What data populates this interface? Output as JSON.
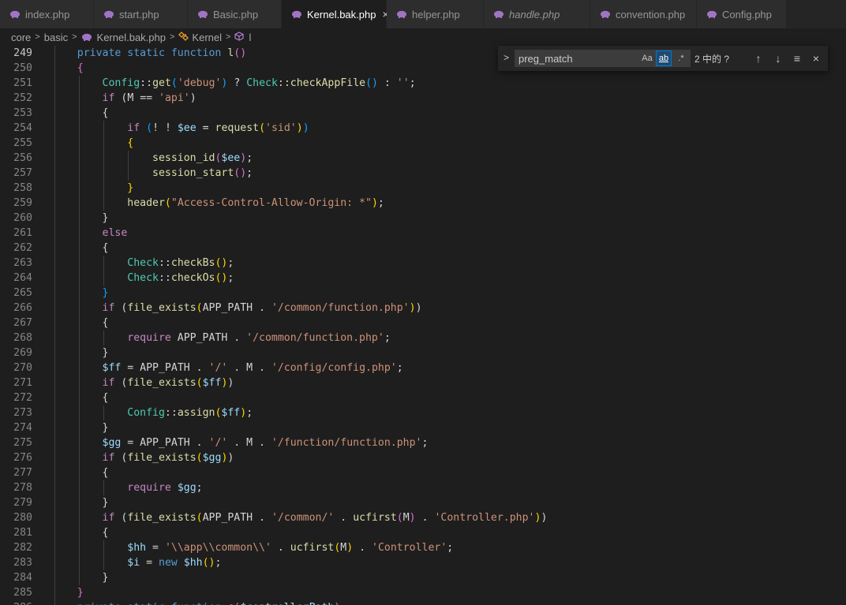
{
  "tabs": [
    {
      "label": "index.php",
      "active": false,
      "italic": false
    },
    {
      "label": "start.php",
      "active": false,
      "italic": false
    },
    {
      "label": "Basic.php",
      "active": false,
      "italic": false
    },
    {
      "label": "Kernel.bak.php",
      "active": true,
      "italic": false,
      "close": "×"
    },
    {
      "label": "helper.php",
      "active": false,
      "italic": false
    },
    {
      "label": "handle.php",
      "active": false,
      "italic": true
    },
    {
      "label": "convention.php",
      "active": false,
      "italic": false
    },
    {
      "label": "Config.php",
      "active": false,
      "italic": false
    }
  ],
  "breadcrumb": {
    "folder1": "core",
    "folder2": "basic",
    "file": "Kernel.bak.php",
    "class": "Kernel",
    "method": "l",
    "separator": ">"
  },
  "find_widget": {
    "query": "preg_match",
    "match_case": "Aa",
    "whole_word": "ab",
    "regex": ".*",
    "result": "2 中的 ?",
    "prev": "↑",
    "next": "↓",
    "selection": "≡",
    "close": "×",
    "toggle": ">"
  },
  "editor": {
    "current_line": 249,
    "lines": [
      {
        "n": "249",
        "t": [
          [
            "    ",
            ""
          ],
          [
            "private static function ",
            "kw"
          ],
          [
            "l",
            "fn"
          ],
          [
            "()",
            "b2"
          ]
        ]
      },
      {
        "n": "250",
        "t": [
          [
            "    ",
            ""
          ],
          [
            "{",
            "b2"
          ]
        ]
      },
      {
        "n": "251",
        "t": [
          [
            "        ",
            ""
          ],
          [
            "Config",
            "cls"
          ],
          [
            "::",
            ""
          ],
          [
            "get",
            "fn"
          ],
          [
            "(",
            "b3"
          ],
          [
            "'debug'",
            "str"
          ],
          [
            "b3_close",
            "b3"
          ],
          [
            " ? ",
            ""
          ],
          [
            "Check",
            "cls"
          ],
          [
            "::",
            ""
          ],
          [
            "checkAppFile",
            "fn"
          ],
          [
            "()",
            "b3"
          ],
          [
            " : ",
            ""
          ],
          [
            "''",
            "str"
          ],
          [
            ";",
            ""
          ]
        ]
      },
      {
        "n": "252",
        "t": [
          [
            "        ",
            ""
          ],
          [
            "if",
            "ctl"
          ],
          [
            " (",
            ""
          ],
          [
            "M == ",
            ""
          ],
          [
            "'api'",
            "str"
          ],
          [
            ")",
            ""
          ]
        ]
      },
      {
        "n": "253",
        "t": [
          [
            "        ",
            ""
          ],
          [
            "{",
            ""
          ]
        ]
      },
      {
        "n": "254",
        "t": [
          [
            "            ",
            ""
          ],
          [
            "if",
            "ctl"
          ],
          [
            " ",
            ""
          ],
          [
            "(",
            "b3"
          ],
          [
            "! ! ",
            ""
          ],
          [
            "$ee",
            "var"
          ],
          [
            " = ",
            ""
          ],
          [
            "request",
            "fn"
          ],
          [
            "(",
            "b1"
          ],
          [
            "'sid'",
            "str"
          ],
          [
            ")",
            "b1"
          ],
          [
            ")",
            "b3"
          ]
        ]
      },
      {
        "n": "255",
        "t": [
          [
            "            ",
            ""
          ],
          [
            "{",
            "b1"
          ]
        ]
      },
      {
        "n": "256",
        "t": [
          [
            "                ",
            ""
          ],
          [
            "session_id",
            "fn"
          ],
          [
            "(",
            "b2"
          ],
          [
            "$ee",
            "var"
          ],
          [
            ")",
            "b2"
          ],
          [
            ";",
            ""
          ]
        ]
      },
      {
        "n": "257",
        "t": [
          [
            "                ",
            ""
          ],
          [
            "session_start",
            "fn"
          ],
          [
            "()",
            "b2"
          ],
          [
            ";",
            ""
          ]
        ]
      },
      {
        "n": "258",
        "t": [
          [
            "            ",
            ""
          ],
          [
            "}",
            "b1"
          ]
        ]
      },
      {
        "n": "259",
        "t": [
          [
            "            ",
            ""
          ],
          [
            "header",
            "fn"
          ],
          [
            "(",
            "b1"
          ],
          [
            "\"Access-Control-Allow-Origin: *\"",
            "str"
          ],
          [
            ")",
            "b1"
          ],
          [
            ";",
            ""
          ]
        ]
      },
      {
        "n": "260",
        "t": [
          [
            "        ",
            ""
          ],
          [
            "}",
            ""
          ]
        ]
      },
      {
        "n": "261",
        "t": [
          [
            "        ",
            ""
          ],
          [
            "else",
            "ctl"
          ]
        ]
      },
      {
        "n": "262",
        "t": [
          [
            "        ",
            ""
          ],
          [
            "{",
            ""
          ]
        ]
      },
      {
        "n": "263",
        "t": [
          [
            "            ",
            ""
          ],
          [
            "Check",
            "cls"
          ],
          [
            "::",
            ""
          ],
          [
            "checkBs",
            "fn"
          ],
          [
            "()",
            "b1"
          ],
          [
            ";",
            ""
          ]
        ]
      },
      {
        "n": "264",
        "t": [
          [
            "            ",
            ""
          ],
          [
            "Check",
            "cls"
          ],
          [
            "::",
            ""
          ],
          [
            "checkOs",
            "fn"
          ],
          [
            "()",
            "b1"
          ],
          [
            ";",
            ""
          ]
        ]
      },
      {
        "n": "265",
        "t": [
          [
            "        ",
            ""
          ],
          [
            "}",
            "b3"
          ]
        ]
      },
      {
        "n": "266",
        "t": [
          [
            "        ",
            ""
          ],
          [
            "if",
            "ctl"
          ],
          [
            " (",
            ""
          ],
          [
            "file_exists",
            "fn"
          ],
          [
            "(",
            "b1"
          ],
          [
            "APP_PATH . ",
            ""
          ],
          [
            "'/common/function.php'",
            "str"
          ],
          [
            ")",
            "b1"
          ],
          [
            ")",
            ""
          ]
        ]
      },
      {
        "n": "267",
        "t": [
          [
            "        ",
            ""
          ],
          [
            "{",
            ""
          ]
        ]
      },
      {
        "n": "268",
        "t": [
          [
            "            ",
            ""
          ],
          [
            "require",
            "ctl"
          ],
          [
            " APP_PATH . ",
            ""
          ],
          [
            "'/common/function.php'",
            "str"
          ],
          [
            ";",
            ""
          ]
        ]
      },
      {
        "n": "269",
        "t": [
          [
            "        ",
            ""
          ],
          [
            "}",
            ""
          ]
        ]
      },
      {
        "n": "270",
        "t": [
          [
            "        ",
            ""
          ],
          [
            "$ff",
            "var"
          ],
          [
            " = APP_PATH . ",
            ""
          ],
          [
            "'/'",
            "str"
          ],
          [
            " . M . ",
            ""
          ],
          [
            "'/config/config.php'",
            "str"
          ],
          [
            ";",
            ""
          ]
        ]
      },
      {
        "n": "271",
        "t": [
          [
            "        ",
            ""
          ],
          [
            "if",
            "ctl"
          ],
          [
            " (",
            ""
          ],
          [
            "file_exists",
            "fn"
          ],
          [
            "(",
            "b1"
          ],
          [
            "$ff",
            "var"
          ],
          [
            ")",
            "b1"
          ],
          [
            ")",
            ""
          ]
        ]
      },
      {
        "n": "272",
        "t": [
          [
            "        ",
            ""
          ],
          [
            "{",
            ""
          ]
        ]
      },
      {
        "n": "273",
        "t": [
          [
            "            ",
            ""
          ],
          [
            "Config",
            "cls"
          ],
          [
            "::",
            ""
          ],
          [
            "assign",
            "fn"
          ],
          [
            "(",
            "b1"
          ],
          [
            "$ff",
            "var"
          ],
          [
            ")",
            "b1"
          ],
          [
            ";",
            ""
          ]
        ]
      },
      {
        "n": "274",
        "t": [
          [
            "        ",
            ""
          ],
          [
            "}",
            ""
          ]
        ]
      },
      {
        "n": "275",
        "t": [
          [
            "        ",
            ""
          ],
          [
            "$gg",
            "var"
          ],
          [
            " = APP_PATH . ",
            ""
          ],
          [
            "'/'",
            "str"
          ],
          [
            " . M . ",
            ""
          ],
          [
            "'/function/function.php'",
            "str"
          ],
          [
            ";",
            ""
          ]
        ]
      },
      {
        "n": "276",
        "t": [
          [
            "        ",
            ""
          ],
          [
            "if",
            "ctl"
          ],
          [
            " (",
            ""
          ],
          [
            "file_exists",
            "fn"
          ],
          [
            "(",
            "b1"
          ],
          [
            "$gg",
            "var"
          ],
          [
            ")",
            "b1"
          ],
          [
            ")",
            ""
          ]
        ]
      },
      {
        "n": "277",
        "t": [
          [
            "        ",
            ""
          ],
          [
            "{",
            ""
          ]
        ]
      },
      {
        "n": "278",
        "t": [
          [
            "            ",
            ""
          ],
          [
            "require",
            "ctl"
          ],
          [
            " ",
            ""
          ],
          [
            "$gg",
            "var"
          ],
          [
            ";",
            ""
          ]
        ]
      },
      {
        "n": "279",
        "t": [
          [
            "        ",
            ""
          ],
          [
            "}",
            ""
          ]
        ]
      },
      {
        "n": "280",
        "t": [
          [
            "        ",
            ""
          ],
          [
            "if",
            "ctl"
          ],
          [
            " (",
            ""
          ],
          [
            "file_exists",
            "fn"
          ],
          [
            "(",
            "b1"
          ],
          [
            "APP_PATH . ",
            ""
          ],
          [
            "'/common/'",
            "str"
          ],
          [
            " . ",
            ""
          ],
          [
            "ucfirst",
            "fn"
          ],
          [
            "(",
            "b2"
          ],
          [
            "M",
            ""
          ],
          [
            ")",
            "b2"
          ],
          [
            " . ",
            ""
          ],
          [
            "'Controller.php'",
            "str"
          ],
          [
            ")",
            "b1"
          ],
          [
            ")",
            ""
          ]
        ]
      },
      {
        "n": "281",
        "t": [
          [
            "        ",
            ""
          ],
          [
            "{",
            ""
          ]
        ]
      },
      {
        "n": "282",
        "t": [
          [
            "            ",
            ""
          ],
          [
            "$hh",
            "var"
          ],
          [
            " = ",
            ""
          ],
          [
            "'\\\\app\\\\common\\\\'",
            "str"
          ],
          [
            " . ",
            ""
          ],
          [
            "ucfirst",
            "fn"
          ],
          [
            "(",
            "b1"
          ],
          [
            "M",
            ""
          ],
          [
            ")",
            "b1"
          ],
          [
            " . ",
            ""
          ],
          [
            "'Controller'",
            "str"
          ],
          [
            ";",
            ""
          ]
        ]
      },
      {
        "n": "283",
        "t": [
          [
            "            ",
            ""
          ],
          [
            "$i",
            "var"
          ],
          [
            " = ",
            ""
          ],
          [
            "new",
            "kw"
          ],
          [
            " ",
            ""
          ],
          [
            "$hh",
            "var"
          ],
          [
            "()",
            "b1"
          ],
          [
            ";",
            ""
          ]
        ]
      },
      {
        "n": "284",
        "t": [
          [
            "        ",
            ""
          ],
          [
            "}",
            ""
          ]
        ]
      },
      {
        "n": "285",
        "t": [
          [
            "    ",
            ""
          ],
          [
            "}",
            "b2"
          ]
        ]
      },
      {
        "n": "286",
        "t": [
          [
            "    ",
            ""
          ],
          [
            "private static function ",
            "kw"
          ],
          [
            "c",
            "fn"
          ],
          [
            "(",
            "b2"
          ],
          [
            "$controllerPath",
            "var"
          ],
          [
            ")",
            "b2"
          ]
        ]
      }
    ]
  },
  "colors": {
    "background": "#1e1e1e",
    "tab_active": "#1e1e1e",
    "tab_inactive": "#2d2d2d",
    "php_icon": "#a074c4",
    "keyword": "#569cd6",
    "control": "#c586c0",
    "function": "#dcdcaa",
    "class": "#4ec9b0",
    "string": "#ce9178",
    "variable": "#9cdcfe"
  },
  "icons": {
    "tab_file": "php-elephant-icon",
    "breadcrumb_file": "php-elephant-icon",
    "breadcrumb_class": "class-icon",
    "breadcrumb_method": "method-cube-icon"
  }
}
